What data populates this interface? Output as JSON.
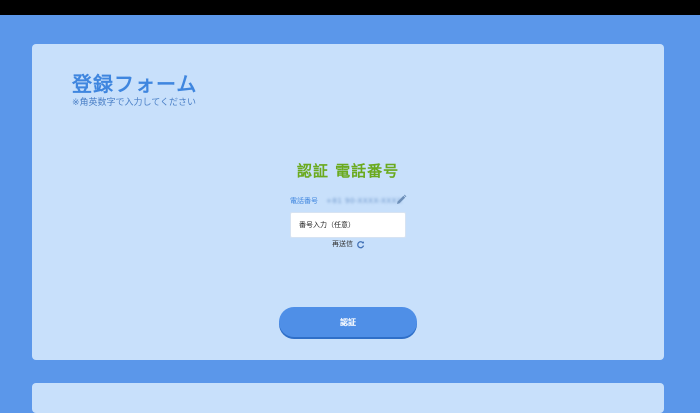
{
  "form": {
    "title": "登録フォーム",
    "note": "※角英数字で入力してください"
  },
  "verification": {
    "title": "認証 電話番号",
    "phone_label": "電話番号",
    "phone_value": "+81 90-XXXX-XXXX",
    "code_placeholder": "番号入力（任意）",
    "resend_label": "再送信",
    "submit_label": "認証"
  },
  "icons": {
    "edit": "pencil-icon",
    "resend": "refresh-icon"
  },
  "colors": {
    "background": "#5b97ea",
    "card": "#c8e0fb",
    "title_blue": "#3f86df",
    "verify_green": "#6aaa1e",
    "button": "#4f8fe7"
  }
}
